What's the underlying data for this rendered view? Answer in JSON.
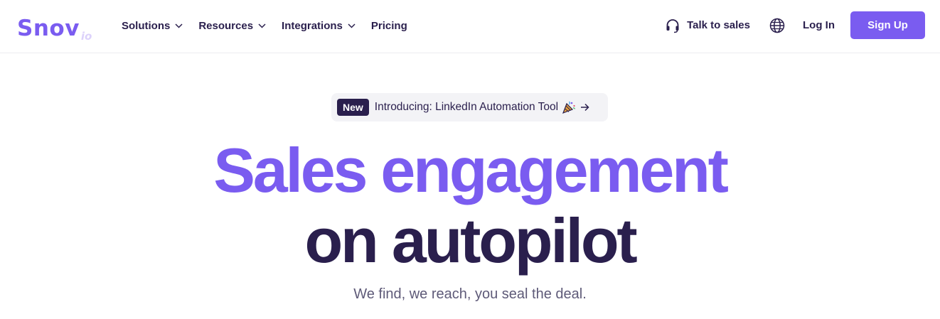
{
  "header": {
    "logo": {
      "main": "Snov",
      "sub": "io"
    },
    "nav": [
      {
        "label": "Solutions",
        "has_dropdown": true
      },
      {
        "label": "Resources",
        "has_dropdown": true
      },
      {
        "label": "Integrations",
        "has_dropdown": true
      },
      {
        "label": "Pricing",
        "has_dropdown": false
      }
    ],
    "talk_to_sales": {
      "label": "Talk to sales",
      "icon": "headset-icon"
    },
    "language": {
      "icon": "globe-icon"
    },
    "login_label": "Log In",
    "signup_label": "Sign Up"
  },
  "hero": {
    "badge": "New",
    "announcement": "Introducing: LinkedIn Automation Tool",
    "announcement_icon": "party-popper-icon",
    "announcement_arrow": "arrow-right-icon",
    "headline_line1": "Sales engagement",
    "headline_line2": "on autopilot",
    "subtitle": "We find, we reach, you seal the deal."
  },
  "colors": {
    "accent": "#7a5cf0",
    "dark": "#2a1f4d",
    "muted": "#5e5a78",
    "badge_bg": "#f3f3f6"
  }
}
